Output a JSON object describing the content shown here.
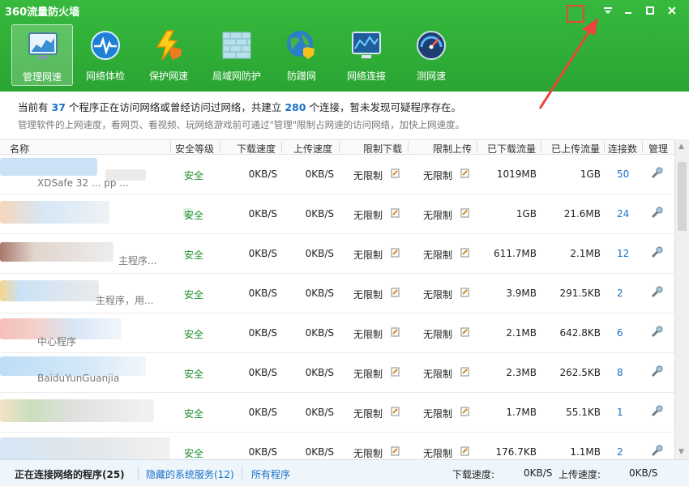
{
  "app": {
    "title": "360流量防火墙"
  },
  "toolbar": [
    {
      "label": "管理网速",
      "icon": "monitor-chart-icon",
      "active": true
    },
    {
      "label": "网络体检",
      "icon": "pulse-globe-icon"
    },
    {
      "label": "保护网速",
      "icon": "lightning-shield-icon"
    },
    {
      "label": "局域网防护",
      "icon": "brick-wall-icon"
    },
    {
      "label": "防蹭网",
      "icon": "globe-shield-icon"
    },
    {
      "label": "网络连接",
      "icon": "network-monitor-icon"
    },
    {
      "label": "测网速",
      "icon": "speedometer-icon"
    }
  ],
  "info": {
    "l1_a": "当前有",
    "programs": "37",
    "l1_b": "个程序正在访问网络或曾经访问过网络，共建立",
    "connections": "280",
    "l1_c": "个连接，暂未发现可疑程序存在。",
    "l2": "管理软件的上网速度，看网页、看视频、玩网络游戏前可通过\"管理\"限制占网速的访问网络，加快上网速度。"
  },
  "columns": [
    "名称",
    "安全等级",
    "下载速度",
    "上传速度",
    "限制下载",
    "限制上传",
    "已下载流量",
    "已上传流量",
    "连接数",
    "管理"
  ],
  "rows": [
    {
      "name": "XDSafe 32 ... pp ...",
      "safety": "安全",
      "down": "0KB/S",
      "up": "0KB/S",
      "limit_down": "无限制",
      "limit_up": "无限制",
      "downloaded": "1019MB",
      "uploaded": "1GB",
      "conns": "50"
    },
    {
      "name": "",
      "safety": "安全",
      "down": "0KB/S",
      "up": "0KB/S",
      "limit_down": "无限制",
      "limit_up": "无限制",
      "downloaded": "1GB",
      "uploaded": "21.6MB",
      "conns": "24"
    },
    {
      "name": "主程序...",
      "safety": "安全",
      "down": "0KB/S",
      "up": "0KB/S",
      "limit_down": "无限制",
      "limit_up": "无限制",
      "downloaded": "611.7MB",
      "uploaded": "2.1MB",
      "conns": "12"
    },
    {
      "name": "主程序，用...",
      "safety": "安全",
      "down": "0KB/S",
      "up": "0KB/S",
      "limit_down": "无限制",
      "limit_up": "无限制",
      "downloaded": "3.9MB",
      "uploaded": "291.5KB",
      "conns": "2"
    },
    {
      "name": "中心程序",
      "safety": "安全",
      "down": "0KB/S",
      "up": "0KB/S",
      "limit_down": "无限制",
      "limit_up": "无限制",
      "downloaded": "2.1MB",
      "uploaded": "642.8KB",
      "conns": "6"
    },
    {
      "name": "BaiduYunGuanjia",
      "safety": "安全",
      "down": "0KB/S",
      "up": "0KB/S",
      "limit_down": "无限制",
      "limit_up": "无限制",
      "downloaded": "2.3MB",
      "uploaded": "262.5KB",
      "conns": "8"
    },
    {
      "name": "",
      "safety": "安全",
      "down": "0KB/S",
      "up": "0KB/S",
      "limit_down": "无限制",
      "limit_up": "无限制",
      "downloaded": "1.7MB",
      "uploaded": "55.1KB",
      "conns": "1"
    },
    {
      "name": "",
      "safety": "安全",
      "down": "0KB/S",
      "up": "0KB/S",
      "limit_down": "无限制",
      "limit_up": "无限制",
      "downloaded": "176.7KB",
      "uploaded": "1.1MB",
      "conns": "2"
    }
  ],
  "status": {
    "tab_active": "正在连接网络的程序(25)",
    "tab_hidden": "隐藏的系统服务(12)",
    "tab_all": "所有程序",
    "down_label": "下载速度:",
    "down_value": "0KB/S",
    "up_label": "上传速度:",
    "up_value": "0KB/S"
  },
  "colors": {
    "green": "#2aa532",
    "safe": "#1f8f2a",
    "link": "#1a6fc8",
    "annotation": "#e8453c"
  }
}
